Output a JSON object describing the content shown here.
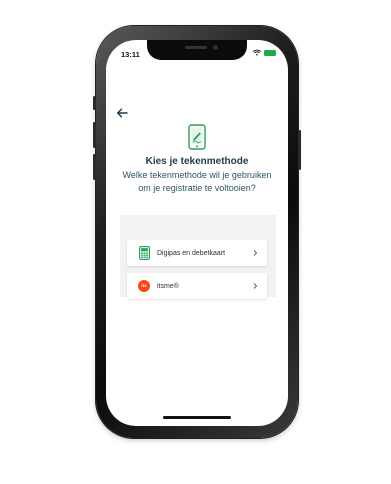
{
  "status_bar": {
    "time": "13:11",
    "battery_color": "#1fa84a"
  },
  "header": {
    "back_icon": "arrow-left-icon",
    "hero_icon": "phone-signature-icon"
  },
  "main": {
    "title": "Kies je tekenmethode",
    "subtitle": "Welke tekenmethode wil je gebruiken om je registratie te voltooien?",
    "options": [
      {
        "label": "Digipas en debetkaart",
        "icon": "digipas-icon"
      },
      {
        "label": "itsme®",
        "icon": "itsme-logo-icon",
        "logo_text": "its me"
      }
    ]
  },
  "colors": {
    "accent": "#2e9e5b",
    "title": "#1e3c4a",
    "itsme": "#ff4612"
  }
}
